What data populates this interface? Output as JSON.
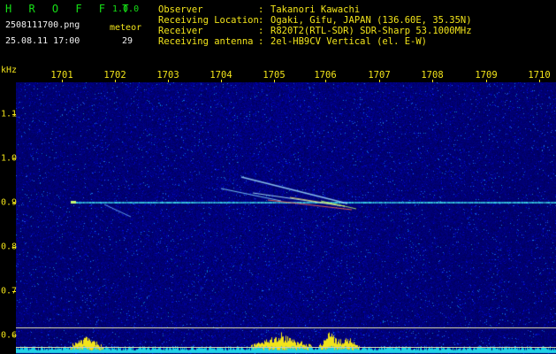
{
  "header": {
    "app_name": "H R O F F T",
    "version": "1.0.0",
    "filename": "2508111700.png",
    "timestamp": "25.08.11 17:00",
    "meteor_label": "meteor",
    "meteor_count": "29",
    "info": [
      {
        "label": "Observer",
        "value": "Takanori Kawachi"
      },
      {
        "label": "Receiving Location",
        "value": "Ogaki, Gifu, JAPAN (136.60E, 35.35N)"
      },
      {
        "label": "Receiver",
        "value": "R820T2(RTL-SDR) SDR-Sharp 53.1000MHz"
      },
      {
        "label": "Receiving antenna",
        "value": "2el-HB9CV Vertical (el. E-W)"
      }
    ]
  },
  "axes": {
    "y_unit": "kHz",
    "x_ticks": [
      "1701",
      "1702",
      "1703",
      "1704",
      "1705",
      "1706",
      "1707",
      "1708",
      "1709",
      "1710"
    ],
    "y_ticks": [
      "1.1",
      "1.0",
      "0.9",
      "0.8",
      "0.7",
      "0.6"
    ]
  },
  "colors": {
    "text_yellow": "#f2e41a",
    "brand_green": "#16e016",
    "background_blue": "#0a0a8c",
    "carrier_cyan": "#3ad6e8",
    "meter_yellow": "#f2e41a",
    "meter_cyan": "#1fd2e6"
  }
}
